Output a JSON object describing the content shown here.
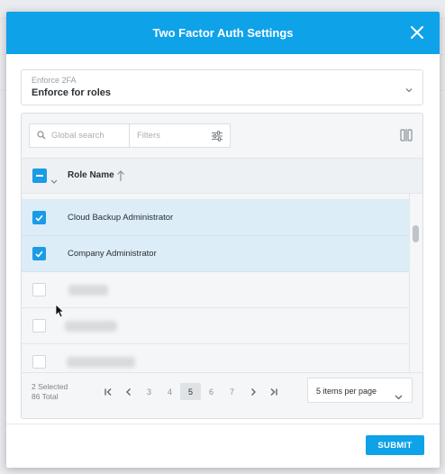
{
  "dialog": {
    "title": "Two Factor Auth Settings",
    "close_icon": "close-icon"
  },
  "enforce": {
    "label": "Enforce 2FA",
    "value": "Enforce for roles"
  },
  "toolbar": {
    "search_placeholder": "Global search",
    "filters_placeholder": "Filters",
    "search_icon": "search-icon",
    "filters_icon": "sliders-icon",
    "columns_icon": "columns-toggle-icon"
  },
  "table": {
    "column_header": "Role Name",
    "sort_direction": "ascending",
    "rows": [
      {
        "name": "Cloud Backup Administrator",
        "checked": true
      },
      {
        "name": "Company Administrator",
        "checked": true
      },
      {
        "name": "",
        "checked": false
      },
      {
        "name": "",
        "checked": false
      },
      {
        "name": "",
        "checked": false
      }
    ]
  },
  "footer": {
    "selected": "2 Selected",
    "total": "86 Total",
    "pages": [
      "3",
      "4",
      "5",
      "6",
      "7"
    ],
    "current_page": "5",
    "per_page": "5 items per page"
  },
  "actions": {
    "submit": "SUBMIT"
  },
  "colors": {
    "accent": "#0ea2e9",
    "checkbox": "#1a9be6",
    "selected_row": "#dcedf7"
  }
}
